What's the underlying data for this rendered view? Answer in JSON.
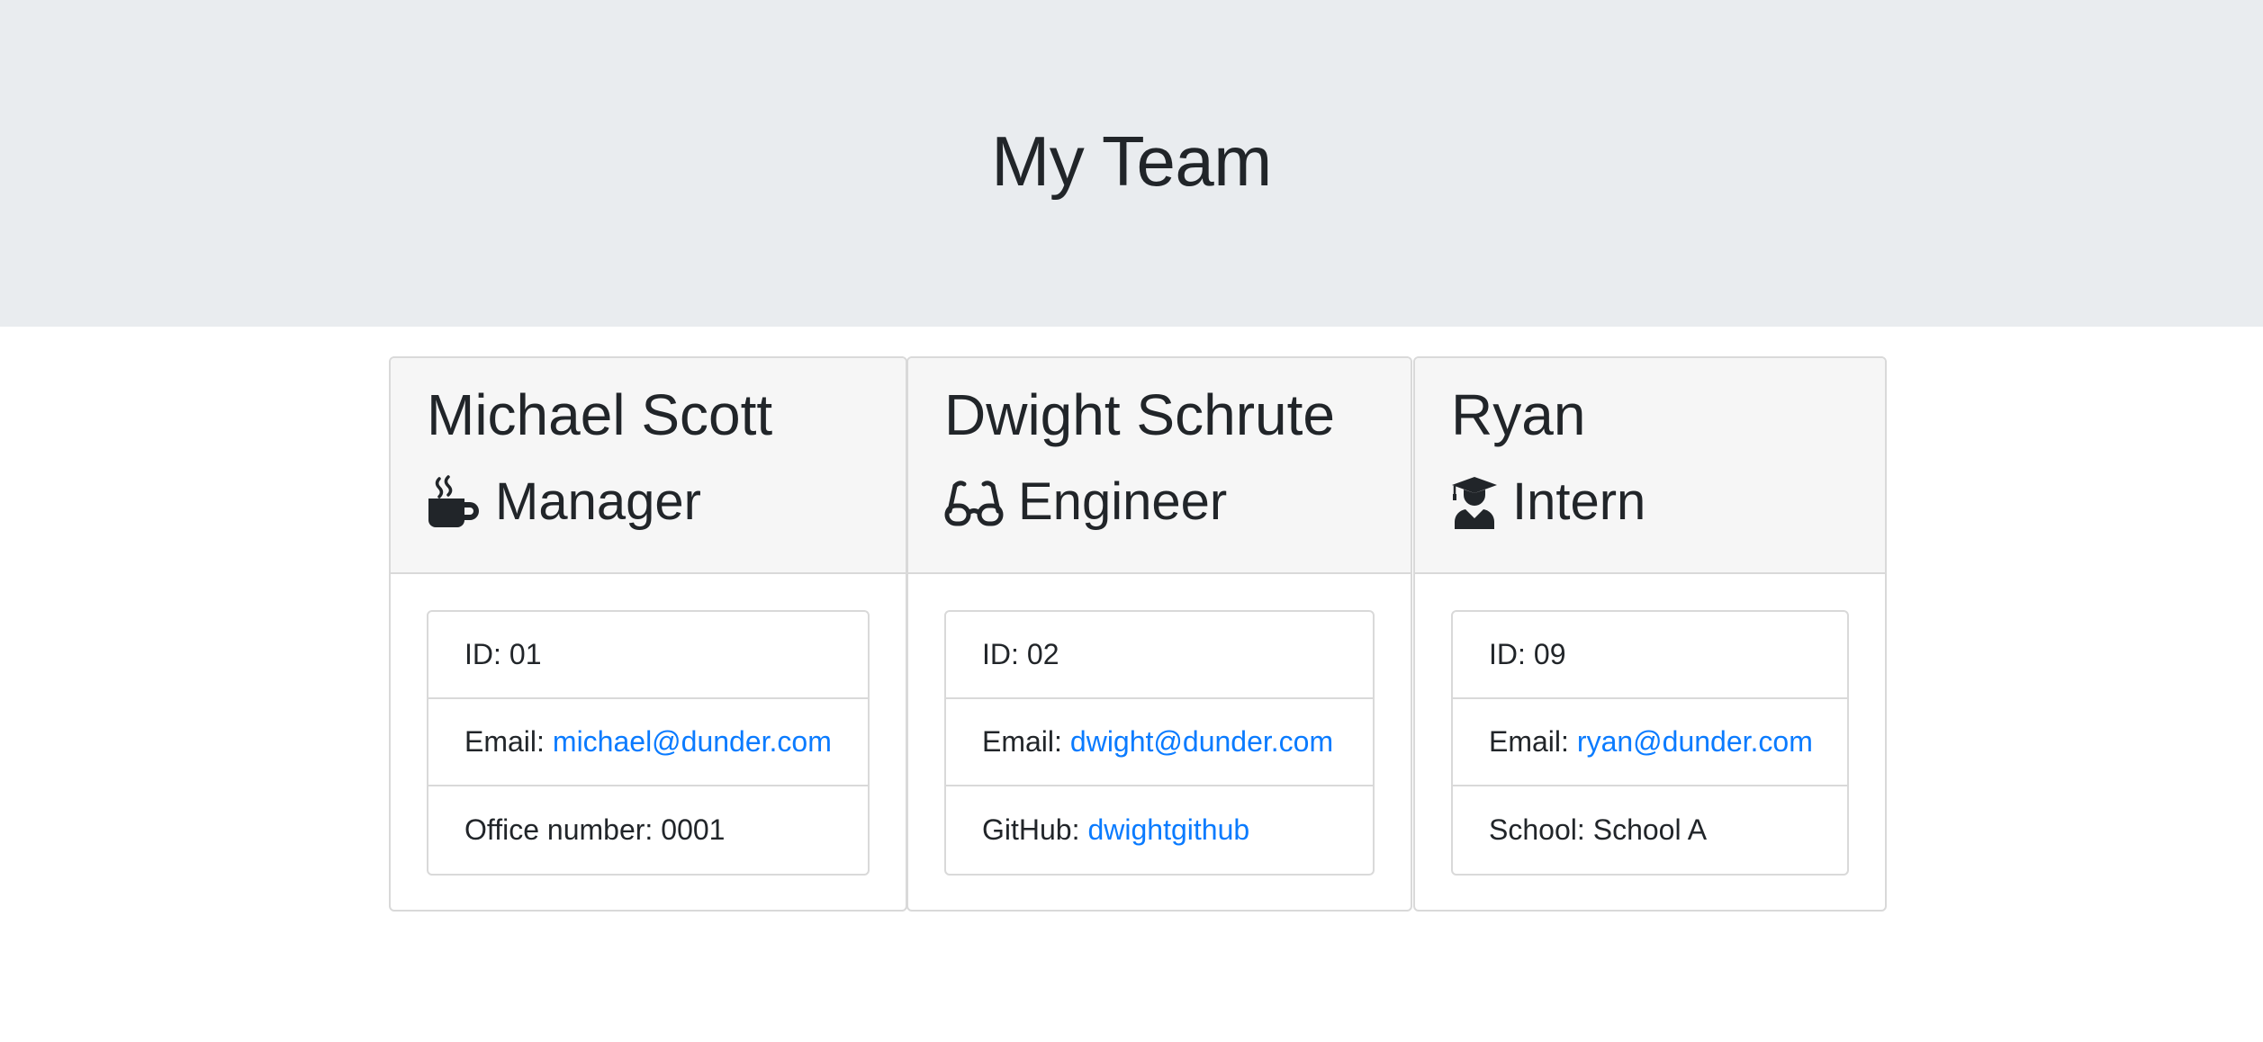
{
  "page": {
    "title": "My Team"
  },
  "colors": {
    "header_bg": "#e9ecef",
    "card_header_bg": "#f6f6f6",
    "link": "#0a7bff",
    "text": "#212529"
  },
  "team": [
    {
      "name": "Michael Scott",
      "role": "Manager",
      "icon": "mug-hot-icon",
      "id_label": "ID:",
      "id_value": "01",
      "email_label": "Email:",
      "email": "michael@dunder.com",
      "extra_label": "Office number:",
      "extra_value": "0001"
    },
    {
      "name": "Dwight Schrute",
      "role": "Engineer",
      "icon": "glasses-icon",
      "id_label": "ID:",
      "id_value": "02",
      "email_label": "Email:",
      "email": "dwight@dunder.com",
      "extra_label": "GitHub:",
      "extra_value": "dwightgithub"
    },
    {
      "name": "Ryan",
      "role": "Intern",
      "icon": "user-graduate-icon",
      "id_label": "ID:",
      "id_value": "09",
      "email_label": "Email:",
      "email": "ryan@dunder.com",
      "extra_label": "School:",
      "extra_value": "School A"
    }
  ]
}
